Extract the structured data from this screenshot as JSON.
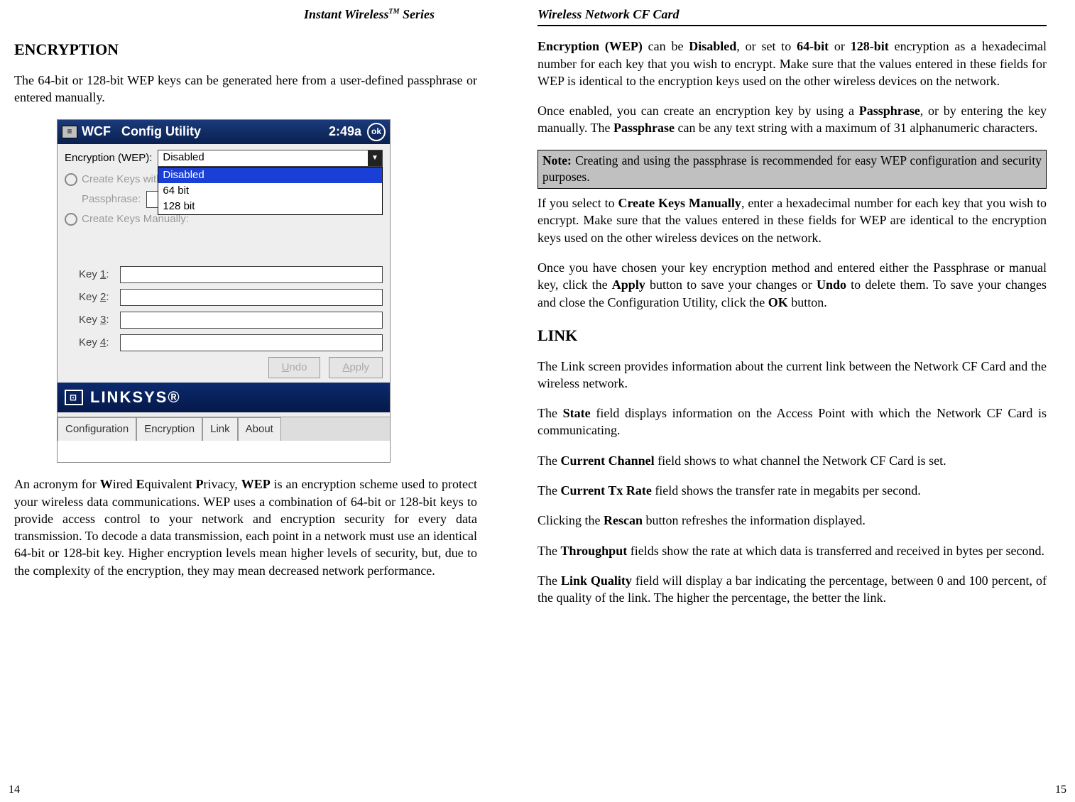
{
  "left": {
    "header": "Instant Wireless",
    "header_tm": "TM",
    "header_suffix": " Series",
    "section": "ENCRYPTION",
    "p1": "The 64-bit or 128-bit WEP keys can be generated here from a user-defined passphrase or entered manually.",
    "p2_a": "An acronym for ",
    "p2_b1": "W",
    "p2_c": "ired ",
    "p2_b2": "E",
    "p2_d": "quivalent ",
    "p2_b3": "P",
    "p2_e": "rivacy, ",
    "p2_b4": "WEP",
    "p2_f": " is an encryption scheme used to protect your wireless data communications. WEP uses a combination of 64-bit or 128-bit keys to provide access control to your network and encryption security for every data transmission. To decode a data transmission, each point in a network must use an identical 64-bit or 128-bit key.   Higher encryption levels mean higher levels of security, but, due to the complexity of the encryption, they may mean decreased network performance.",
    "page_number": "14"
  },
  "screenshot": {
    "app_name": "WCF",
    "title_suffix": "Config Utility",
    "time": "2:49a",
    "ok": "ok",
    "encryption_label": "Encryption (WEP):",
    "combo_value": "Disabled",
    "options": [
      "Disabled",
      "64 bit",
      "128 bit"
    ],
    "radio1": "Create Keys with Pas",
    "passphrase_label": "Passphrase:",
    "radio2": "Create Keys Manually:",
    "keys": [
      "Key 1:",
      "Key 2:",
      "Key 3:",
      "Key 4:"
    ],
    "undo": "Undo",
    "apply": "Apply",
    "brand": "LINKSYS®",
    "tabs": [
      "Configuration",
      "Encryption",
      "Link",
      "About"
    ]
  },
  "right": {
    "header": "Wireless Network CF Card",
    "p1_a": "Encryption (WEP)",
    "p1_b": " can be ",
    "p1_c": "Disabled",
    "p1_d": ", or set to ",
    "p1_e": "64-bit",
    "p1_f": " or ",
    "p1_g": "128-bit",
    "p1_h": " encryption as a hexadecimal number for each key that you wish to encrypt.  Make sure that the values entered in these fields for WEP is identical to the encryption keys used on the other wireless devices on the network.",
    "p2_a": "Once enabled, you can create an encryption key by using a ",
    "p2_b": "Passphrase",
    "p2_c": ", or by entering the key manually.  The ",
    "p2_d": "Passphrase",
    "p2_e": " can be any text string with a maximum of 31 alphanumeric characters.",
    "note_a": "Note:",
    "note_b": " Creating and using the passphrase is recommended for easy WEP configuration and security purposes.",
    "p3_a": "If you select to ",
    "p3_b": "Create Keys Manually",
    "p3_c": ", enter a hexadecimal number for each key that you wish to encrypt.  Make sure that the values entered in these fields for WEP are identical to the encryption keys used on the other wireless devices on the network.",
    "p4_a": "Once you have chosen your key encryption method and entered either the Passphrase or manual key, click the ",
    "p4_b": "Apply",
    "p4_c": " button to save your changes or ",
    "p4_d": "Undo",
    "p4_e": " to delete them. To save your changes and close the Configuration Utility, click the ",
    "p4_f": "OK",
    "p4_g": " button.",
    "section2": "LINK",
    "l1": "The Link screen provides information about the current link between the Network CF Card and the wireless network.",
    "l2_a": "The ",
    "l2_b": "State",
    "l2_c": " field displays information on the Access Point with which the Network CF Card is communicating.",
    "l3_a": "The ",
    "l3_b": "Current Channel",
    "l3_c": " field shows to what channel the Network CF Card is set.",
    "l4_a": "The ",
    "l4_b": "Current Tx Rate",
    "l4_c": " field shows the transfer rate in megabits per second.",
    "l5_a": "Clicking the ",
    "l5_b": "Rescan",
    "l5_c": " button refreshes the information displayed.",
    "l6_a": "The ",
    "l6_b": "Throughput",
    "l6_c": " fields show the rate at which data is transferred and received in bytes per second.",
    "l7_a": "The ",
    "l7_b": "Link Quality",
    "l7_c": " field will display a bar indicating the percentage, between 0 and 100 percent, of the quality of the link.  The higher the percentage, the better the link.",
    "page_number": "15"
  }
}
